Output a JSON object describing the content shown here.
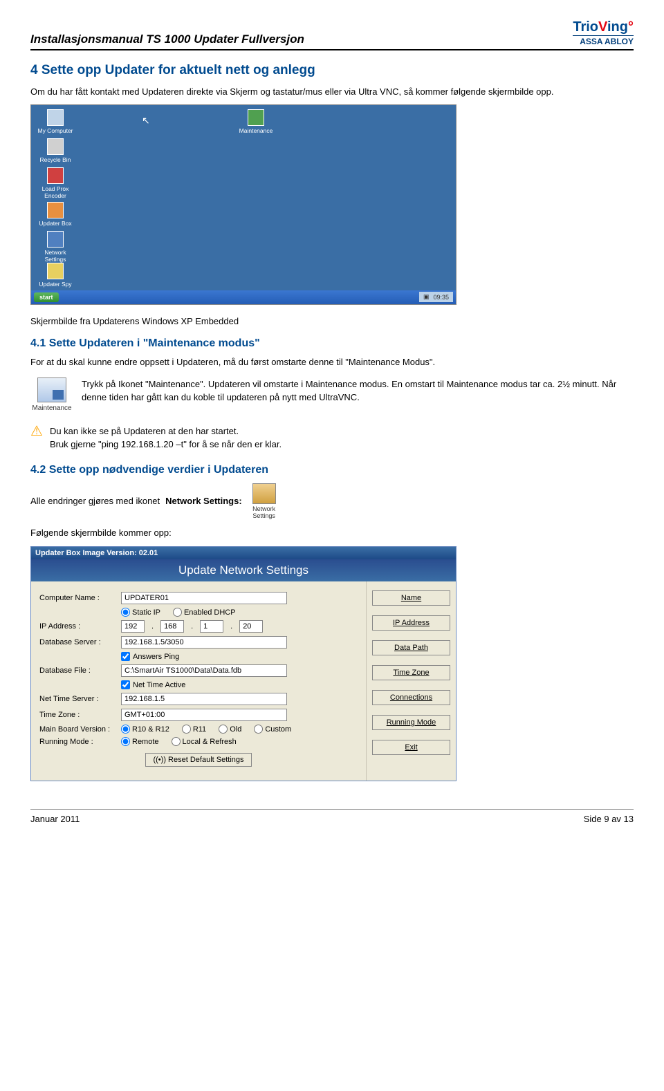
{
  "header": {
    "title": "Installasjonsmanual TS 1000 Updater Fullversjon",
    "brand_trio": "TrioVing",
    "brand_assa": "ASSA ABLOY"
  },
  "h1": "4  Sette opp Updater for aktuelt nett og anlegg",
  "p1": "Om du har fått kontakt med Updateren direkte via Skjerm og tastatur/mus eller via Ultra VNC, så kommer følgende skjermbilde opp.",
  "desktop": {
    "icons": {
      "my_computer": "My Computer",
      "recycle": "Recycle Bin",
      "load_prox": "Load Prox Encoder",
      "updater_box": "Updater Box",
      "network": "Network Settings",
      "spy": "Updater Spy",
      "maintenance": "Maintenance"
    },
    "start": "start",
    "clock": "09:35"
  },
  "caption1": "Skjermbilde fra Updaterens Windows XP Embedded",
  "h41": "4.1 Sette Updateren i \"Maintenance modus\"",
  "p41": "For at du skal kunne endre oppsett i Updateren, må du først omstarte denne til \"Maintenance Modus\".",
  "maint_icon_label": "Maintenance",
  "maint_text": "Trykk på Ikonet \"Maintenance\". Updateren vil omstarte i Maintenance modus. En omstart til Maintenance modus tar ca. 2½ minutt. Når denne tiden har gått kan du koble til updateren på nytt med UltraVNC.",
  "note_line1": "Du kan ikke se på Updateren at den har startet.",
  "note_line2": "Bruk gjerne \"ping 192.168.1.20 –t\" for å se når den er klar.",
  "h42": "4.2 Sette opp nødvendige verdier i Updateren",
  "p42a": "Alle endringer gjøres med ikonet ",
  "p42a_bold": "Network Settings:",
  "netset_icon_label": "Network Settings",
  "p42b": "Følgende skjermbilde kommer opp:",
  "dlg": {
    "title": "Updater Box Image Version: 02.01",
    "banner": "Update Network Settings",
    "labels": {
      "computer": "Computer Name :",
      "ip": "IP Address :",
      "dbserver": "Database Server :",
      "dbfile": "Database File :",
      "nettime": "Net Time Server :",
      "tz": "Time Zone :",
      "mbv": "Main Board Version :",
      "rmode": "Running Mode :"
    },
    "values": {
      "computer": "UPDATER01",
      "ip1": "192",
      "ip2": "168",
      "ip3": "1",
      "ip4": "20",
      "dbserver": "192.168.1.5/3050",
      "answers_ping": "Answers Ping",
      "dbfile": "C:\\SmartAir TS1000\\Data\\Data.fdb",
      "nettime_active": "Net Time Active",
      "nettime": "192.168.1.5",
      "tz": "GMT+01:00"
    },
    "radios": {
      "static_ip": "Static IP",
      "enabled_dhcp": "Enabled DHCP",
      "mbv_r10": "R10 & R12",
      "mbv_r11": "R11",
      "mbv_old": "Old",
      "mbv_custom": "Custom",
      "rmode_remote": "Remote",
      "rmode_local": "Local & Refresh"
    },
    "side": {
      "name": "Name",
      "ip": "IP Address",
      "datapath": "Data Path",
      "tz": "Time Zone",
      "conn": "Connections",
      "rmode": "Running Mode",
      "exit": "Exit"
    },
    "reset": "Reset Default Settings"
  },
  "footer": {
    "left": "Januar 2011",
    "right": "Side 9 av 13"
  }
}
